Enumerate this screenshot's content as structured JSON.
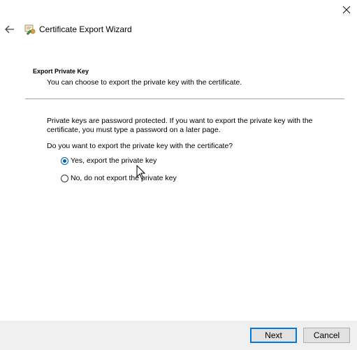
{
  "window": {
    "title": "Certificate Export Wizard",
    "close_icon": "close-icon",
    "back_icon": "back-arrow-icon",
    "wizard_icon": "certificate-icon"
  },
  "section": {
    "title": "Export Private Key",
    "subtitle": "You can choose to export the private key with the certificate."
  },
  "body": {
    "description": "Private keys are password protected. If you want to export the private key with the certificate, you must type a password on a later page.",
    "question": "Do you want to export the private key with the certificate?"
  },
  "options": [
    {
      "label": "Yes, export the private key",
      "selected": true
    },
    {
      "label": "No, do not export the private key",
      "selected": false
    }
  ],
  "buttons": {
    "next": "Next",
    "cancel": "Cancel"
  },
  "colors": {
    "accent": "#0078d7",
    "footer": "#f0f0f0"
  }
}
